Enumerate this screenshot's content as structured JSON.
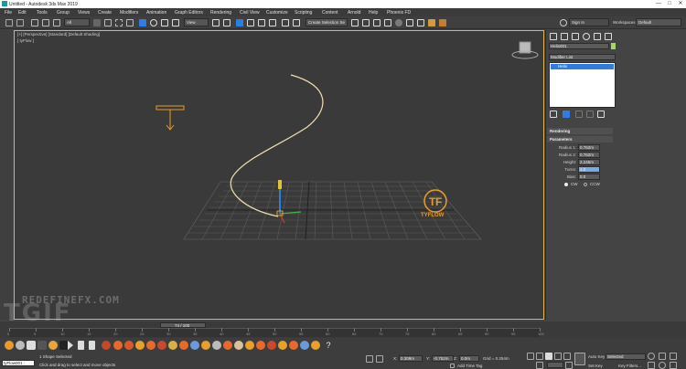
{
  "window": {
    "title": "Untitled - Autodesk 3ds Max 2019",
    "controls": [
      "—",
      "□",
      "✕"
    ]
  },
  "menu": [
    "File",
    "Edit",
    "Tools",
    "Group",
    "Views",
    "Create",
    "Modifiers",
    "Animation",
    "Graph Editors",
    "Rendering",
    "Civil View",
    "Customize",
    "Scripting",
    "Content",
    "Arnold",
    "Help",
    "Phoenix FD"
  ],
  "toolbar": {
    "selection_filter": "All",
    "view_dropdown": "View",
    "selection_set": "Create Selection Se",
    "signin": "Sign In",
    "workspaces_label": "Workspaces:",
    "workspaces_value": "Default"
  },
  "viewport": {
    "label": "[+] [Perspective] [Standard] [Default Shading]",
    "object_label": "[ tyFlow ]",
    "logo_text": "TYFLOW",
    "watermark_top": "REDEFINEFX.COM",
    "watermark_big": "TGIF"
  },
  "command_panel": {
    "object_name": "Helix001",
    "modifier_list": "Modifier List",
    "stack_item": "Helix",
    "rollouts": {
      "rendering": "Rendering",
      "parameters": "Parameters"
    },
    "params": [
      {
        "label": "Radius 1:",
        "value": "0.762m"
      },
      {
        "label": "Radius 2:",
        "value": "0.762m"
      },
      {
        "label": "Height:",
        "value": "2.245m"
      },
      {
        "label": "Turns:",
        "value": "1.0"
      },
      {
        "label": "Bias:",
        "value": "0.0"
      }
    ],
    "direction": {
      "cw": "CW",
      "ccw": "CCW"
    }
  },
  "timeline": {
    "frame_label": "74 / 100",
    "ticks": [
      "0",
      "5",
      "10",
      "15",
      "20",
      "25",
      "30",
      "35",
      "40",
      "45",
      "50",
      "55",
      "60",
      "65",
      "70",
      "75",
      "80",
      "85",
      "90",
      "95",
      "100"
    ]
  },
  "status": {
    "script_field": "tyFlow001 :",
    "selection": "1 Shape Selected",
    "prompt": "Click and drag to select and move objects",
    "x_label": "X:",
    "x": "0.309m",
    "y_label": "Y:",
    "y": "-0.752m",
    "z_label": "Z:",
    "z": "0.0m",
    "grid": "Grid = 0.254m",
    "add_time_tag": "Add Time Tag",
    "auto_key": "Auto Key",
    "set_key": "Set Key",
    "selected": "Selected",
    "key_filters": "Key Filters..."
  },
  "colors": {
    "accent_orange": "#e89a2b",
    "viewport_border": "#dcb34e",
    "blue": "#2f7de1"
  }
}
